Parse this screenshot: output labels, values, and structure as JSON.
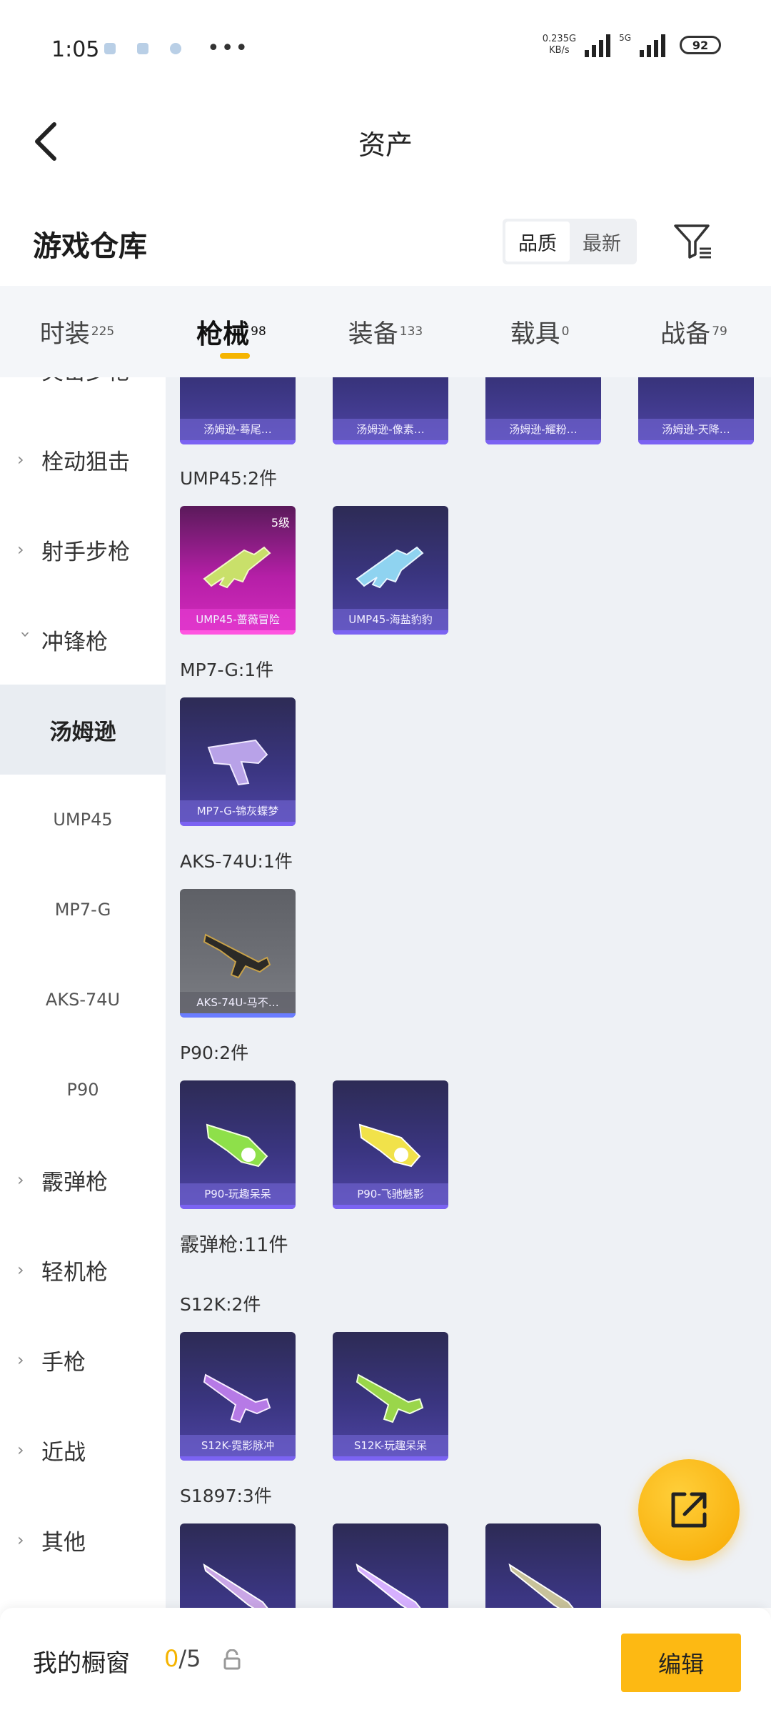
{
  "status_bar": {
    "time": "1:05",
    "net_speed_top": "0.23",
    "net_speed_unit": "KB/s",
    "network_1": "5G",
    "network_2": "5G",
    "battery": "92"
  },
  "header": {
    "title": "资产",
    "back_icon": "chevron-left-icon"
  },
  "sub_header": {
    "title": "游戏仓库",
    "sort_options": [
      "品质",
      "最新"
    ],
    "sort_active": "品质",
    "filter_icon": "filter-icon"
  },
  "tabs": [
    {
      "label": "时装",
      "count": "225",
      "active": false
    },
    {
      "label": "枪械",
      "count": "98",
      "active": true
    },
    {
      "label": "装备",
      "count": "133",
      "active": false
    },
    {
      "label": "载具",
      "count": "0",
      "active": false
    },
    {
      "label": "战备",
      "count": "79",
      "active": false
    }
  ],
  "sidebar": {
    "items": [
      {
        "label": "突击步枪",
        "type": "category",
        "expanded": false
      },
      {
        "label": "栓动狙击",
        "type": "category",
        "expanded": false
      },
      {
        "label": "射手步枪",
        "type": "category",
        "expanded": false
      },
      {
        "label": "冲锋枪",
        "type": "category",
        "expanded": true
      },
      {
        "label": "汤姆逊",
        "type": "sub",
        "active": true
      },
      {
        "label": "UMP45",
        "type": "sub",
        "active": false
      },
      {
        "label": "MP7-G",
        "type": "sub",
        "active": false
      },
      {
        "label": "AKS-74U",
        "type": "sub",
        "active": false
      },
      {
        "label": "P90",
        "type": "sub",
        "active": false
      },
      {
        "label": "霰弹枪",
        "type": "category",
        "expanded": false
      },
      {
        "label": "轻机枪",
        "type": "category",
        "expanded": false
      },
      {
        "label": "手枪",
        "type": "category",
        "expanded": false
      },
      {
        "label": "近战",
        "type": "category",
        "expanded": false
      },
      {
        "label": "其他",
        "type": "category",
        "expanded": false
      }
    ]
  },
  "content": {
    "top_row_cards": [
      "汤姆逊-蓦尾…",
      "汤姆逊-像素…",
      "汤姆逊-耀粉…",
      "汤姆逊-天降…"
    ],
    "sections": [
      {
        "label": "UMP45:2件",
        "cards": [
          {
            "name": "UMP45-蔷薇冒险",
            "level": "5级",
            "style": "pink"
          },
          {
            "name": "UMP45-海盐豹豹",
            "level": "",
            "style": "purple"
          }
        ]
      },
      {
        "label": "MP7-G:1件",
        "cards": [
          {
            "name": "MP7-G-锦灰蝶梦",
            "level": "",
            "style": "purple"
          }
        ]
      },
      {
        "label": "AKS-74U:1件",
        "cards": [
          {
            "name": "AKS-74U-马不…",
            "level": "",
            "style": "grey"
          }
        ]
      },
      {
        "label": "P90:2件",
        "cards": [
          {
            "name": "P90-玩趣呆呆",
            "level": "",
            "style": "purple"
          },
          {
            "name": "P90-飞驰魅影",
            "level": "",
            "style": "purple"
          }
        ]
      },
      {
        "label": "霰弹枪:11件",
        "cards": []
      },
      {
        "label": "S12K:2件",
        "cards": [
          {
            "name": "S12K-霓影脉冲",
            "level": "",
            "style": "purple"
          },
          {
            "name": "S12K-玩趣呆呆",
            "level": "",
            "style": "purple"
          }
        ]
      },
      {
        "label": "S1897:3件",
        "cards": [
          {
            "name": "",
            "level": "",
            "style": "purple"
          },
          {
            "name": "",
            "level": "",
            "style": "purple"
          },
          {
            "name": "",
            "level": "",
            "style": "purple"
          }
        ]
      }
    ]
  },
  "fab": {
    "icon": "share-icon"
  },
  "bottom_bar": {
    "label": "我的橱窗",
    "count_current": "0",
    "count_total": "/5",
    "lock_icon": "lock-icon",
    "edit_label": "编辑"
  },
  "colors": {
    "accent": "#f5b400",
    "content_bg": "#eef1f5",
    "card_purple": "#3a3580",
    "card_pink": "#b51fa7",
    "card_grey": "#6f7177"
  }
}
